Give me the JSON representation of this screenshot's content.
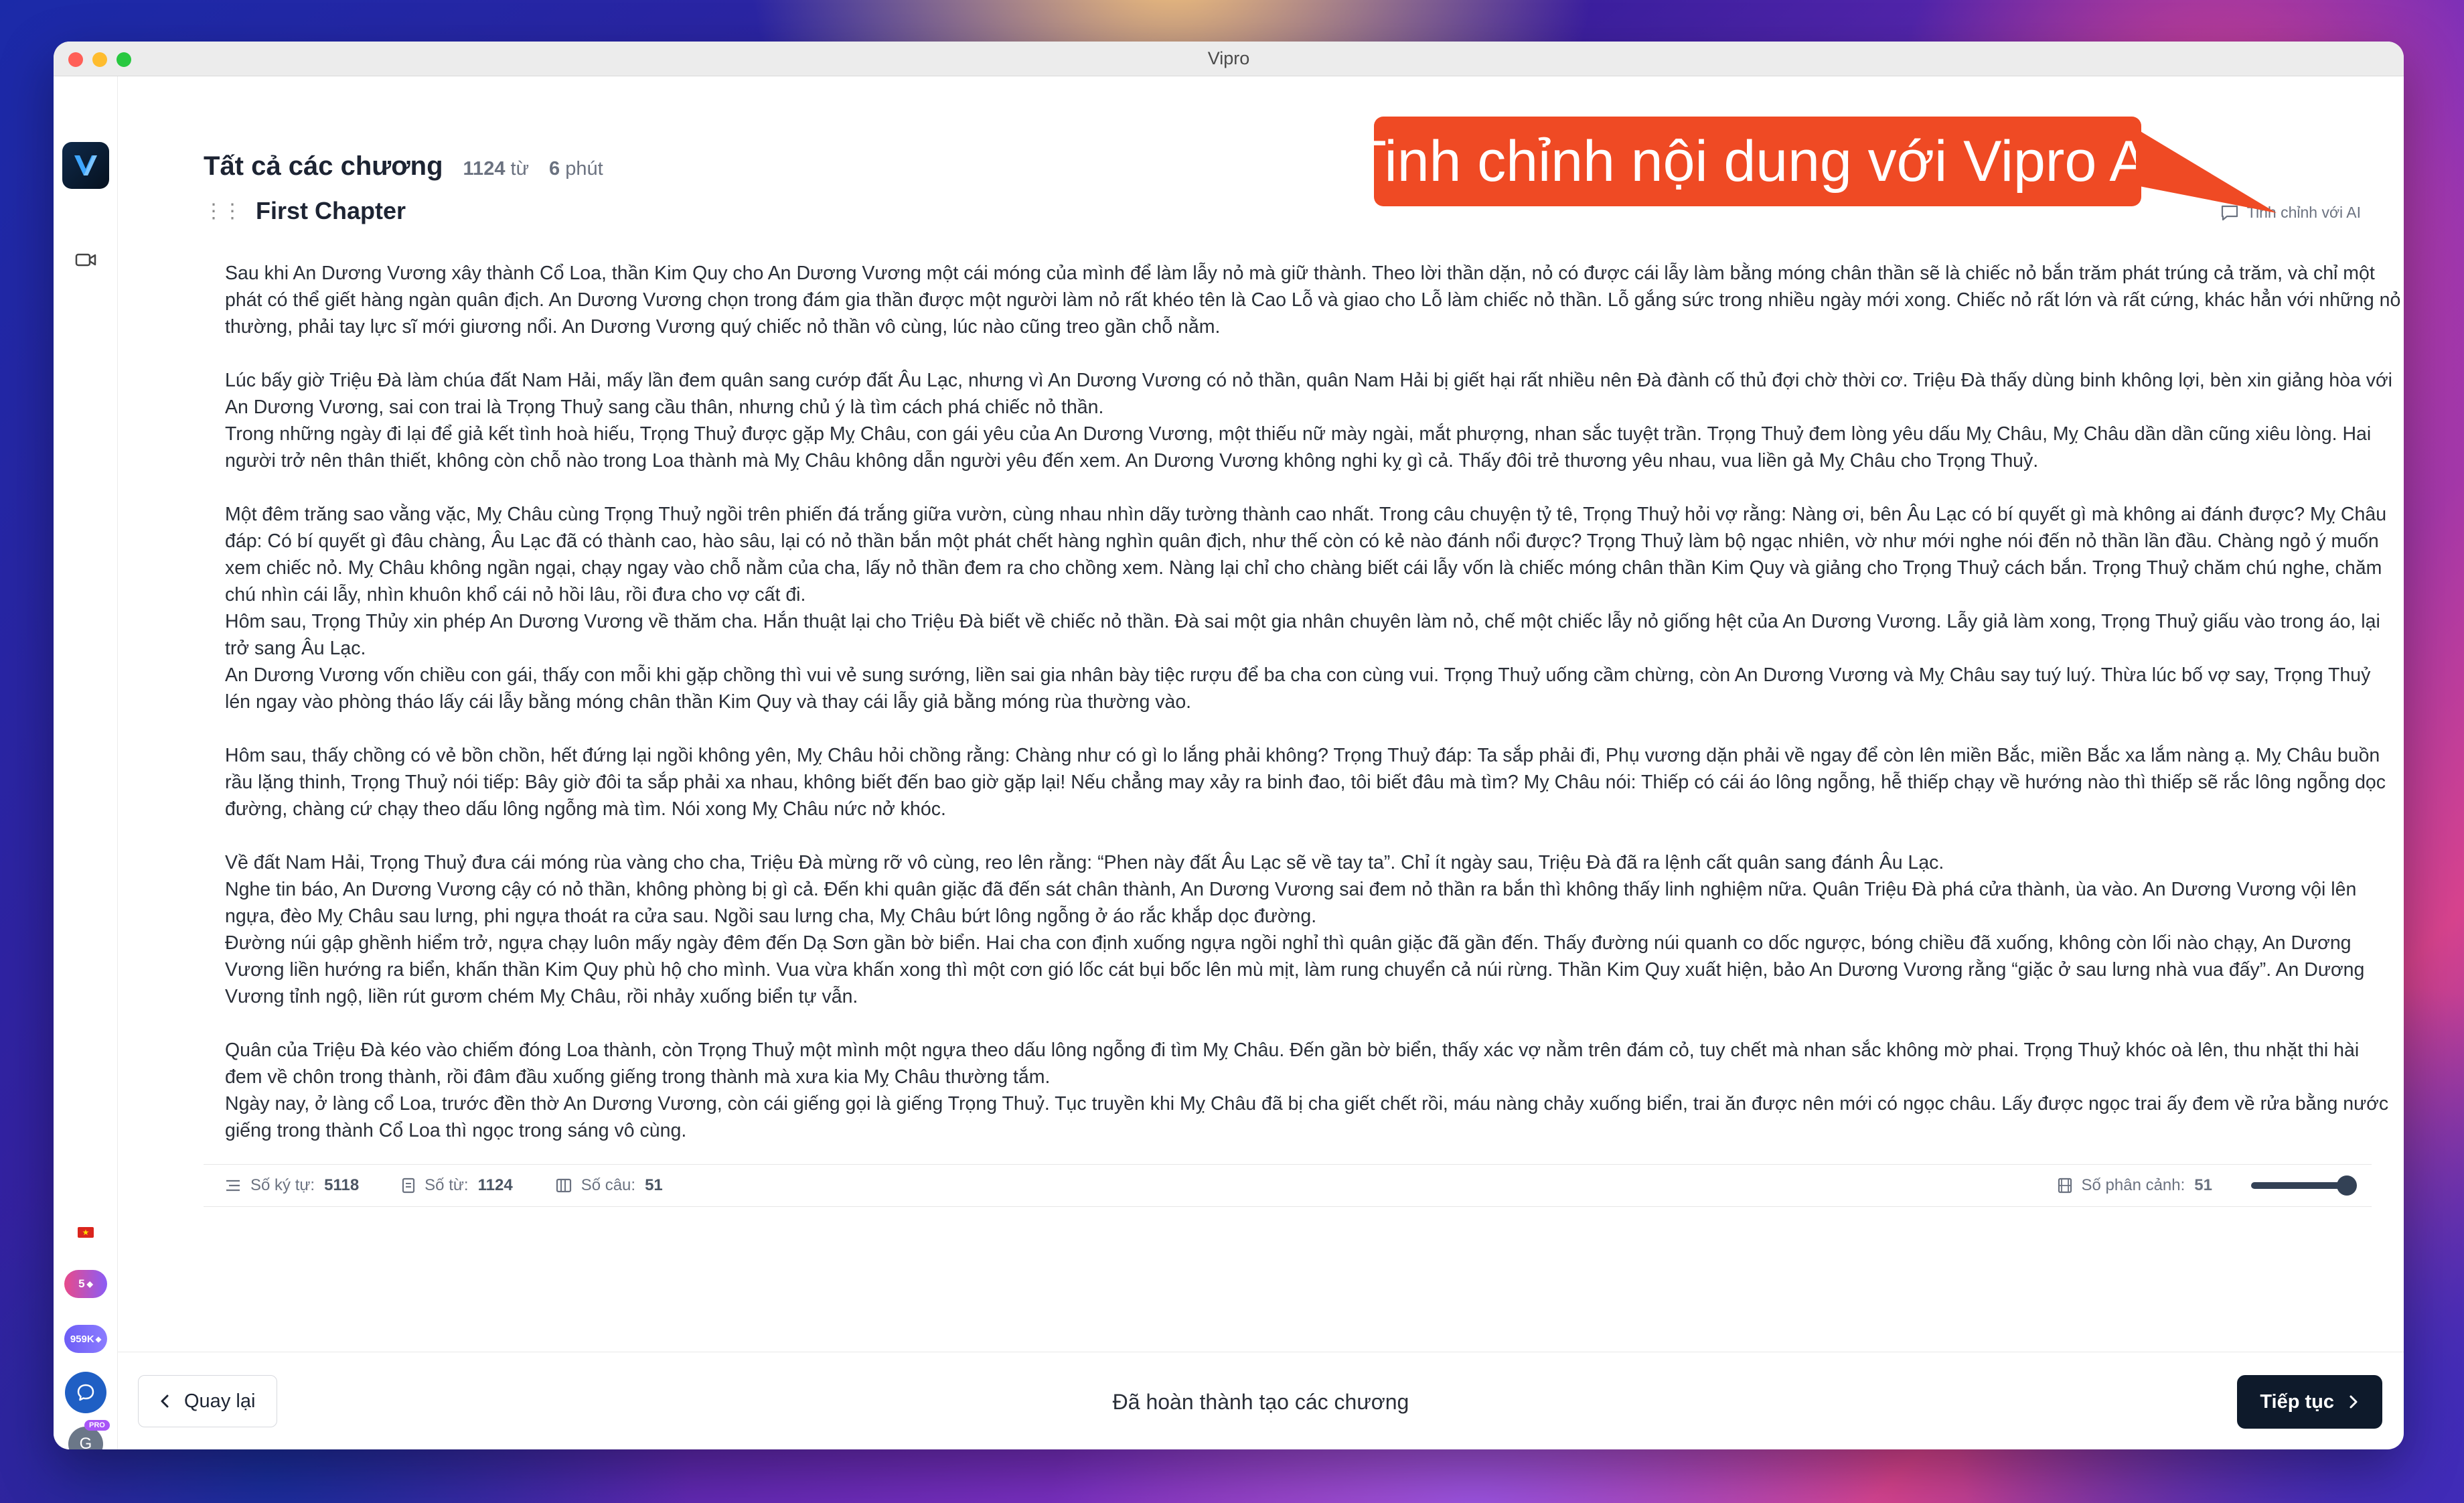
{
  "window": {
    "title": "Vipro"
  },
  "header": {
    "title": "Tất cả các chương",
    "word_count": "1124",
    "word_unit": "từ",
    "minutes": "6",
    "minute_unit": "phút"
  },
  "chapter": {
    "title": "First Chapter"
  },
  "refine": {
    "label": "Tinh chỉnh với AI"
  },
  "callout": {
    "text": "Tinh chỉnh nội dung với Vipro AI"
  },
  "content": {
    "paragraphs": [
      "Sau khi An Dương Vương xây thành Cổ Loa, thần Kim Quy cho An Dương Vương một cái móng của mình để làm lẫy nỏ mà giữ thành. Theo lời thần dặn, nỏ có được cái lẫy làm bằng móng chân thần sẽ là chiếc nỏ bắn trăm phát trúng cả trăm, và chỉ một phát có thể giết hàng ngàn quân địch. An Dương Vương chọn trong đám gia thần được một người làm nỏ rất khéo tên là Cao Lỗ và giao cho Lỗ làm chiếc nỏ thần. Lỗ gắng sức trong nhiều ngày mới xong. Chiếc nỏ rất lớn và rất cứng, khác hẳn với những nỏ thường, phải tay lực sĩ mới giương nổi. An Dương Vương quý chiếc nỏ thần vô cùng, lúc nào cũng treo gần chỗ nằm.",
      "",
      "Lúc bấy giờ Triệu Đà làm chúa đất Nam Hải, mấy lần đem quân sang cướp đất Âu Lạc, nhưng vì An Dương Vương có nỏ thần, quân Nam Hải bị giết hại rất nhiều nên Đà đành cố thủ đợi chờ thời cơ. Triệu Đà thấy dùng binh không lợi, bèn xin giảng hòa với An Dương Vương, sai con trai là Trọng Thuỷ sang cầu thân, nhưng chủ ý là tìm cách phá chiếc nỏ thần.",
      "Trong những ngày đi lại để giả kết tình hoà hiếu, Trọng Thuỷ được gặp Mỵ Châu, con gái yêu của An Dương Vương, một thiếu nữ mày ngài, mắt phượng, nhan sắc tuyệt trần. Trọng Thuỷ đem lòng yêu dấu Mỵ Châu, Mỵ Châu dần dần cũng xiêu lòng. Hai người trở nên thân thiết, không còn chỗ nào trong Loa thành mà Mỵ Châu không dẫn người yêu đến xem. An Dương Vương không nghi kỵ gì cả. Thấy đôi trẻ thương yêu nhau, vua liền gả Mỵ Châu cho Trọng Thuỷ.",
      "",
      "Một đêm trăng sao vằng vặc, Mỵ Châu cùng Trọng Thuỷ ngồi trên phiến đá trắng giữa vườn, cùng nhau nhìn dãy tường thành cao nhất. Trong câu chuyện tỷ tê, Trọng Thuỷ hỏi vợ rằng: Nàng ơi, bên Âu Lạc có bí quyết gì mà không ai đánh được? Mỵ Châu đáp: Có bí quyết gì đâu chàng, Âu Lạc đã có thành cao, hào sâu, lại có nỏ thần bắn một phát chết hàng nghìn quân địch, như thế còn có kẻ nào đánh nổi được? Trọng Thuỷ làm bộ ngạc nhiên, vờ như mới nghe nói đến nỏ thần lần đầu. Chàng ngỏ ý muốn xem chiếc nỏ. Mỵ Châu không ngần ngại, chạy ngay vào chỗ nằm của cha, lấy nỏ thần đem ra cho chồng xem. Nàng lại chỉ cho chàng biết cái lẫy vốn là chiếc móng chân thần Kim Quy và giảng cho Trọng Thuỷ cách bắn. Trọng Thuỷ chăm chú nghe, chăm chú nhìn cái lẫy, nhìn khuôn khổ cái nỏ hồi lâu, rồi đưa cho vợ cất đi.",
      "Hôm sau, Trọng Thủy xin phép An Dương Vương về thăm cha. Hắn thuật lại cho Triệu Đà biết về chiếc nỏ thần. Đà sai một gia nhân chuyên làm nỏ, chế một chiếc lẫy nỏ giống hệt của An Dương Vương. Lẫy giả làm xong, Trọng Thuỷ giấu vào trong áo, lại trở sang Âu Lạc.",
      "An Dương Vương vốn chiều con gái, thấy con mỗi khi gặp chồng thì vui vẻ sung sướng, liền sai gia nhân bày tiệc rượu để ba cha con cùng vui. Trọng Thuỷ uống cầm chừng, còn An Dương Vương và Mỵ Châu say tuý luý. Thừa lúc bố vợ say, Trọng Thuỷ lén ngay vào phòng tháo lấy cái lẫy bằng móng chân thần Kim Quy và thay cái lẫy giả bằng móng rùa thường vào.",
      "",
      "Hôm sau, thấy chồng có vẻ bồn chồn, hết đứng lại ngồi không yên, Mỵ Châu hỏi chồng rằng: Chàng như có gì lo lắng phải không? Trọng Thuỷ đáp: Ta sắp phải đi, Phụ vương dặn phải về ngay để còn lên miền Bắc, miền Bắc xa lắm nàng ạ. Mỵ Châu buồn rầu lặng thinh, Trọng Thuỷ nói tiếp: Bây giờ đôi ta sắp phải xa nhau, không biết đến bao giờ gặp lại! Nếu chẳng may xảy ra binh đao, tôi biết đâu mà tìm? Mỵ Châu nói: Thiếp có cái áo lông ngỗng, hễ thiếp chạy về hướng nào thì thiếp sẽ rắc lông ngỗng dọc đường, chàng cứ chạy theo dấu lông ngỗng mà tìm. Nói xong Mỵ Châu nức nở khóc.",
      "",
      "Về đất Nam Hải, Trọng Thuỷ đưa cái móng rùa vàng cho cha, Triệu Đà mừng rỡ vô cùng, reo lên rằng: “Phen này đất Âu Lạc sẽ về tay ta”. Chỉ ít ngày sau, Triệu Đà đã ra lệnh cất quân sang đánh Âu Lạc.",
      "Nghe tin báo, An Dương Vương cậy có nỏ thần, không phòng bị gì cả. Đến khi quân giặc đã đến sát chân thành, An Dương Vương sai đem nỏ thần ra bắn thì không thấy linh nghiệm nữa. Quân Triệu Đà phá cửa thành, ùa vào. An Dương Vương vội lên ngựa, đèo Mỵ Châu sau lưng, phi ngựa thoát ra cửa sau. Ngồi sau lưng cha, Mỵ Châu bứt lông ngỗng ở áo rắc khắp dọc đường.",
      "Đường núi gập ghềnh hiểm trở, ngựa chạy luôn mấy ngày đêm đến Dạ Sơn gần bờ biển. Hai cha con định xuống ngựa ngồi nghỉ thì quân giặc đã gần đến. Thấy đường núi quanh co dốc ngược, bóng chiều đã xuống, không còn lối nào chạy, An Dương Vương liền hướng ra biển, khấn thần Kim Quy phù hộ cho mình. Vua vừa khấn xong thì một cơn gió lốc cát bụi bốc lên mù mịt, làm rung chuyển cả núi rừng. Thần Kim Quy xuất hiện, bảo An Dương Vương rằng “giặc ở sau lưng nhà vua đấy”. An Dương Vương tỉnh ngộ, liền rút gươm chém Mỵ Châu, rồi nhảy xuống biển tự vẫn.",
      "",
      "Quân của Triệu Đà kéo vào chiếm đóng Loa thành, còn Trọng Thuỷ một mình một ngựa theo dấu lông ngỗng đi tìm Mỵ Châu. Đến gần bờ biển, thấy xác vợ nằm trên đám cỏ, tuy chết mà nhan sắc không mờ phai. Trọng Thuỷ khóc oà lên, thu nhặt thi hài đem về chôn trong thành, rồi đâm đầu xuống giếng trong thành mà xưa kia Mỵ Châu thường tắm.",
      "Ngày nay, ở làng cổ Loa, trước đền thờ An Dương Vương, còn cái giếng gọi là giếng Trọng Thuỷ. Tục truyền khi Mỵ Châu đã bị cha giết chết rồi, máu nàng chảy xuống biển, trai ăn được nên mới có ngọc châu. Lấy được ngọc trai ấy đem về rửa bằng nước giếng trong thành Cổ Loa thì ngọc trong sáng vô cùng."
    ]
  },
  "stats": {
    "chars_label": "Số ký tự:",
    "chars_value": "5118",
    "words_label": "Số từ:",
    "words_value": "1124",
    "sentences_label": "Số câu:",
    "sentences_value": "51",
    "scenes_label": "Số phân cảnh:",
    "scenes_value": "51",
    "slider_level": 1.0
  },
  "sidebar": {
    "gems_small": "5",
    "gems_large": "959K",
    "avatar_letter": "G",
    "pro_badge": "PRO"
  },
  "footer": {
    "back_label": "Quay lại",
    "status": "Đã hoàn thành tạo các chương",
    "next_label": "Tiếp tục"
  },
  "colors": {
    "callout": "#ef4a24",
    "primary_button": "#0e1a2b",
    "chat_button": "#1f5fc4"
  }
}
